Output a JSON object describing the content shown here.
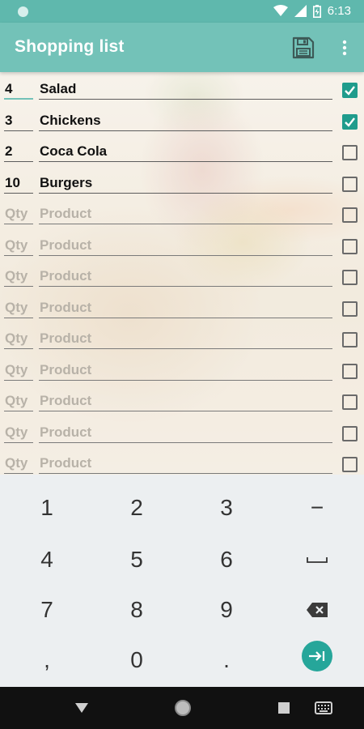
{
  "status_bar": {
    "time": "6:13"
  },
  "app_bar": {
    "title": "Shopping list"
  },
  "list": {
    "placeholder_qty": "Qty",
    "placeholder_product": "Product",
    "items": [
      {
        "qty": "4",
        "product": "Salad",
        "checked": true
      },
      {
        "qty": "3",
        "product": "Chickens",
        "checked": true
      },
      {
        "qty": "2",
        "product": "Coca Cola",
        "checked": false
      },
      {
        "qty": "10",
        "product": "Burgers",
        "checked": false
      },
      {
        "qty": "",
        "product": "",
        "checked": false
      },
      {
        "qty": "",
        "product": "",
        "checked": false
      },
      {
        "qty": "",
        "product": "",
        "checked": false
      },
      {
        "qty": "",
        "product": "",
        "checked": false
      },
      {
        "qty": "",
        "product": "",
        "checked": false
      },
      {
        "qty": "",
        "product": "",
        "checked": false
      },
      {
        "qty": "",
        "product": "",
        "checked": false
      },
      {
        "qty": "",
        "product": "",
        "checked": false
      },
      {
        "qty": "",
        "product": "",
        "checked": false
      }
    ]
  },
  "keyboard": {
    "keys": [
      "1",
      "2",
      "3",
      "−",
      "4",
      "5",
      "6",
      "space",
      "7",
      "8",
      "9",
      "backspace",
      ",",
      "0",
      ".",
      "tab"
    ]
  },
  "colors": {
    "accent": "#73c2b8",
    "status_bar": "#5fb8ad",
    "checkbox_checked": "#1f9c8c",
    "tab_key": "#26a69a"
  },
  "icons": {
    "save": "floppy-disk-icon",
    "more": "more-vert-icon",
    "wifi": "wifi-icon",
    "signal": "cell-signal-icon",
    "battery": "battery-icon",
    "back": "nav-back-icon",
    "home": "nav-home-icon",
    "recents": "nav-recents-icon",
    "keyboard": "keyboard-icon"
  }
}
